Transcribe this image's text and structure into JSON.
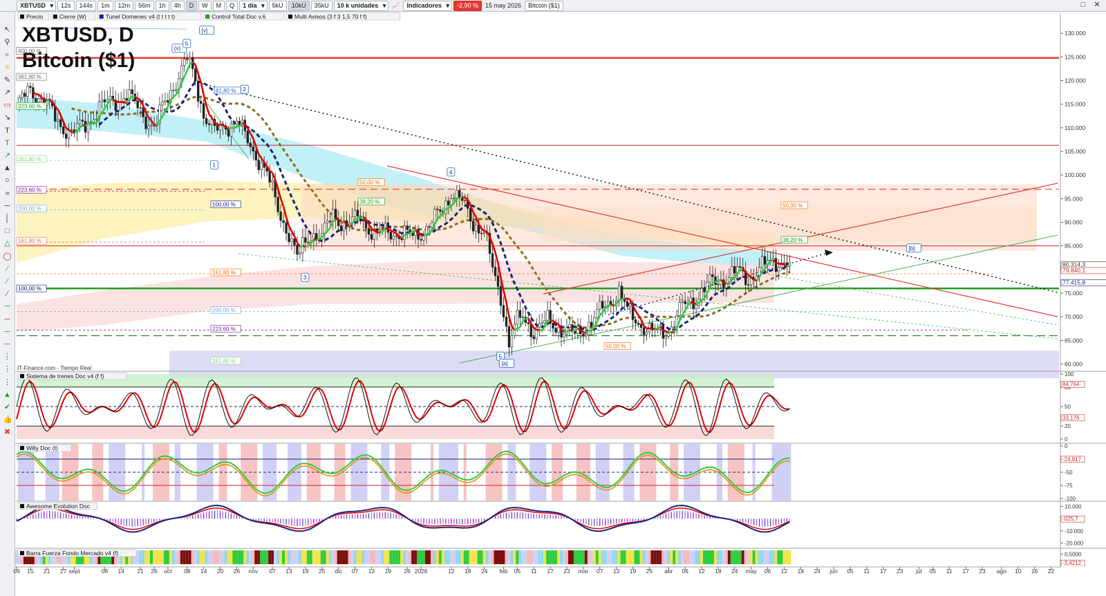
{
  "toolbar": {
    "symbol": "XBTUSD",
    "periods": [
      "12s",
      "144s",
      "1m",
      "12m",
      "56m",
      "1h",
      "4h",
      "D",
      "W",
      "M",
      "Q"
    ],
    "active_period": "D",
    "interval": "1 día",
    "units": [
      "5kU",
      "10kU",
      "35kU"
    ],
    "active_unit": "10kU",
    "quantity": "10 k unidades",
    "indicators_label": "Indicadores",
    "change_badge": "-2,90 %",
    "date": "15 may 2026",
    "instrument": "Bitcoin ($1)"
  },
  "legend_bar": [
    "Precio",
    "Cierre (W)",
    "Tunel Domenec v4 (t t t t t)",
    "Control Total Doc v.6",
    "Multi Avisos (3 f 3 1,5 70 f f)"
  ],
  "chart_data": {
    "type": "line",
    "title": "XBTUSD, D",
    "subtitle": "Bitcoin ($1)",
    "source": "IT-Finance.com - Tiempo Real",
    "colors": {
      "up": "#2ecc40",
      "down": "#e00000",
      "red_line": "#e53935",
      "green_line": "#1e9e1e",
      "navy": "#1a237e",
      "olive": "#8d6e1f"
    },
    "price_axis": {
      "ylim": [
        57000,
        132000
      ],
      "ticks": [
        "130.000",
        "125.000",
        "120.000",
        "115.000",
        "110.000",
        "105.000",
        "100.000",
        "95.000",
        "90.000",
        "85.000",
        "80.000",
        "75.000",
        "70.000",
        "65.000",
        "60.000"
      ]
    },
    "price_labels": [
      "80.314,3",
      "79.840,1",
      "77.415,8"
    ],
    "x_axis_labels": [
      {
        "i": 0,
        "t": "09"
      },
      {
        "i": 5,
        "t": "15"
      },
      {
        "i": 11,
        "t": "21"
      },
      {
        "i": 17,
        "t": "27"
      },
      {
        "i": 21,
        "t": "sept"
      },
      {
        "i": 32,
        "t": "08"
      },
      {
        "i": 38,
        "t": "14"
      },
      {
        "i": 45,
        "t": "21"
      },
      {
        "i": 50,
        "t": "26"
      },
      {
        "i": 55,
        "t": "oct"
      },
      {
        "i": 62,
        "t": "08"
      },
      {
        "i": 68,
        "t": "14"
      },
      {
        "i": 74,
        "t": "20"
      },
      {
        "i": 80,
        "t": "26"
      },
      {
        "i": 86,
        "t": "nov"
      },
      {
        "i": 93,
        "t": "07"
      },
      {
        "i": 99,
        "t": "13"
      },
      {
        "i": 105,
        "t": "19"
      },
      {
        "i": 111,
        "t": "25"
      },
      {
        "i": 117,
        "t": "dic"
      },
      {
        "i": 123,
        "t": "07"
      },
      {
        "i": 129,
        "t": "13"
      },
      {
        "i": 135,
        "t": "19"
      },
      {
        "i": 142,
        "t": "26"
      },
      {
        "i": 147,
        "t": "2026"
      },
      {
        "i": 158,
        "t": "12"
      },
      {
        "i": 164,
        "t": "18"
      },
      {
        "i": 170,
        "t": "24"
      },
      {
        "i": 177,
        "t": "feb"
      },
      {
        "i": 182,
        "t": "05"
      },
      {
        "i": 188,
        "t": "11"
      },
      {
        "i": 194,
        "t": "17"
      },
      {
        "i": 200,
        "t": "23"
      },
      {
        "i": 206,
        "t": "mar"
      },
      {
        "i": 212,
        "t": "07"
      },
      {
        "i": 218,
        "t": "13"
      },
      {
        "i": 224,
        "t": "19"
      },
      {
        "i": 230,
        "t": "25"
      },
      {
        "i": 237,
        "t": "abr"
      },
      {
        "i": 243,
        "t": "06"
      },
      {
        "i": 249,
        "t": "12"
      },
      {
        "i": 255,
        "t": "18"
      },
      {
        "i": 261,
        "t": "24"
      },
      {
        "i": 267,
        "t": "may"
      },
      {
        "i": 273,
        "t": "06"
      },
      {
        "i": 279,
        "t": "12"
      },
      {
        "i": 285,
        "t": "18"
      },
      {
        "i": 291,
        "t": "24"
      },
      {
        "i": 297,
        "t": "jun"
      },
      {
        "i": 303,
        "t": "05"
      },
      {
        "i": 309,
        "t": "11"
      },
      {
        "i": 315,
        "t": "17"
      },
      {
        "i": 321,
        "t": "23"
      },
      {
        "i": 328,
        "t": "jul"
      },
      {
        "i": 333,
        "t": "05"
      },
      {
        "i": 339,
        "t": "11"
      },
      {
        "i": 345,
        "t": "17"
      },
      {
        "i": 351,
        "t": "23"
      },
      {
        "i": 358,
        "t": "ago"
      },
      {
        "i": 364,
        "t": "10"
      },
      {
        "i": 370,
        "t": "16"
      },
      {
        "i": 376,
        "t": "22"
      }
    ],
    "price_anchors": [
      [
        0,
        114500
      ],
      [
        5,
        118000
      ],
      [
        10,
        116000
      ],
      [
        15,
        111000
      ],
      [
        20,
        109000
      ],
      [
        25,
        110500
      ],
      [
        30,
        114500
      ],
      [
        35,
        115500
      ],
      [
        40,
        117000
      ],
      [
        45,
        113500
      ],
      [
        50,
        110000
      ],
      [
        53,
        114000
      ],
      [
        57,
        119000
      ],
      [
        62,
        124500
      ],
      [
        65,
        120000
      ],
      [
        68,
        113000
      ],
      [
        72,
        109000
      ],
      [
        76,
        110500
      ],
      [
        80,
        111500
      ],
      [
        84,
        107000
      ],
      [
        88,
        103500
      ],
      [
        91,
        100000
      ],
      [
        95,
        93000
      ],
      [
        99,
        87500
      ],
      [
        102,
        82000
      ],
      [
        104,
        85000
      ],
      [
        107,
        88000
      ],
      [
        111,
        86500
      ],
      [
        115,
        92000
      ],
      [
        120,
        89000
      ],
      [
        125,
        91500
      ],
      [
        130,
        87000
      ],
      [
        135,
        88500
      ],
      [
        140,
        87000
      ],
      [
        145,
        87500
      ],
      [
        150,
        89000
      ],
      [
        155,
        93000
      ],
      [
        158,
        96500
      ],
      [
        162,
        94000
      ],
      [
        166,
        90000
      ],
      [
        170,
        88000
      ],
      [
        173,
        80000
      ],
      [
        175,
        76000
      ],
      [
        177,
        72000
      ],
      [
        179,
        64000
      ],
      [
        181,
        68000
      ],
      [
        184,
        70000
      ],
      [
        188,
        67000
      ],
      [
        193,
        69000
      ],
      [
        198,
        67500
      ],
      [
        203,
        66000
      ],
      [
        208,
        68500
      ],
      [
        212,
        71000
      ],
      [
        216,
        73500
      ],
      [
        219,
        75500
      ],
      [
        222,
        71000
      ],
      [
        226,
        69000
      ],
      [
        230,
        67000
      ],
      [
        234,
        66500
      ],
      [
        238,
        68000
      ],
      [
        242,
        72000
      ],
      [
        247,
        74000
      ],
      [
        252,
        77000
      ],
      [
        257,
        78000
      ],
      [
        262,
        79500
      ],
      [
        266,
        78000
      ],
      [
        270,
        80000
      ],
      [
        275,
        82000
      ],
      [
        279,
        81500
      ],
      [
        281,
        80300
      ]
    ],
    "price_levels": [
      {
        "value": 124800,
        "color": "#e53935",
        "width": 2.5,
        "dash": ""
      },
      {
        "value": 106300,
        "color": "#c62828",
        "width": 1,
        "dash": ""
      },
      {
        "value": 97000,
        "color": "#e53935",
        "width": 1.2,
        "dash": "10 6"
      },
      {
        "value": 85000,
        "color": "#c62828",
        "width": 1,
        "dash": ""
      },
      {
        "value": 76000,
        "color": "#1e9e1e",
        "width": 2.5,
        "dash": ""
      },
      {
        "value": 66000,
        "color": "#2e7d32",
        "width": 1.2,
        "dash": "12 6"
      }
    ],
    "fibo_labels": [
      {
        "t": "400,00 %",
        "v": 126000,
        "c": "#666"
      },
      {
        "t": "361,80 %",
        "v": 120500,
        "c": "#666"
      },
      {
        "t": "323,60 %",
        "v": 114300,
        "c": "#1e9e1e"
      },
      {
        "t": "261,80 %",
        "v": 103100,
        "c": "#8bd18b"
      },
      {
        "t": "223,60 %",
        "v": 96600,
        "c": "#7b1fa2"
      },
      {
        "t": "200,00 %",
        "v": 92600,
        "c": "#7aa7d9"
      },
      {
        "t": "161,80 %",
        "v": 85800,
        "c": "#e57373"
      },
      {
        "t": "100,00 %",
        "v": 93500,
        "c": "#1a237e"
      },
      {
        "t": "161,80 %",
        "v": 79100,
        "c": "#ef6c00"
      },
      {
        "t": "100,00 %",
        "v": 75700,
        "c": "#1a237e"
      },
      {
        "t": "200,00 %",
        "v": 71100,
        "c": "#7aa7d9"
      },
      {
        "t": "223,60 %",
        "v": 67200,
        "c": "#7b1fa2"
      },
      {
        "t": "261,80 %",
        "v": 60400,
        "c": "#8bd18b"
      },
      {
        "t": "61,80 %",
        "v": 117600,
        "c": "#1565c0"
      },
      {
        "t": "50,00 %",
        "v": 98200,
        "c": "#ef6c00"
      },
      {
        "t": "38,20 %",
        "v": 94100,
        "c": "#1e9e1e"
      },
      {
        "t": "50,00 %",
        "v": 93300,
        "c": "#ef6c00"
      },
      {
        "t": "38,20 %",
        "v": 86000,
        "c": "#1e9e1e"
      },
      {
        "t": "50,00 %",
        "v": 63500,
        "c": "#ef6c00"
      }
    ],
    "wave_labels": [
      {
        "t": "(v)",
        "i": 58,
        "v": 126700
      },
      {
        "t": "5",
        "i": 62,
        "v": 127700
      },
      {
        "t": "[v]",
        "i": 68,
        "v": 130500
      },
      {
        "t": "2",
        "i": 83,
        "v": 118000
      },
      {
        "t": "1",
        "i": 72,
        "v": 102000
      },
      {
        "t": "3",
        "i": 105,
        "v": 78200
      },
      {
        "t": "4",
        "i": 158,
        "v": 100500
      },
      {
        "t": "5",
        "i": 176,
        "v": 61500
      },
      {
        "t": "[a]",
        "i": 177,
        "v": 60000
      },
      {
        "t": "[b]",
        "i": 325,
        "v": 84400
      }
    ],
    "indicators": [
      {
        "name": "Sistema de trenes Doc v4 (f f)",
        "ticks": [
          "100",
          "80",
          "50",
          "20",
          "0"
        ],
        "ylim": [
          0,
          100
        ],
        "labels": [
          "84,764",
          "33,176"
        ]
      },
      {
        "name": "Willy Doc (t)",
        "ticks": [
          "0",
          "-25",
          "-50",
          "-75",
          "-100"
        ],
        "ylim": [
          -100,
          0
        ],
        "labels": [
          "-24,817"
        ]
      },
      {
        "name": "Awesome Evolution Doc",
        "ticks": [
          "10.000",
          "-10.000",
          "-20.000"
        ],
        "ylim": [
          -22000,
          12000
        ],
        "labels": [
          "-025,7"
        ]
      },
      {
        "name": "Barra Fuerza Fondo Mercado v4 (f)",
        "ticks": [
          "0,5000"
        ],
        "ylim": [
          -1,
          1
        ],
        "labels": [
          "-3,4212"
        ]
      }
    ]
  }
}
